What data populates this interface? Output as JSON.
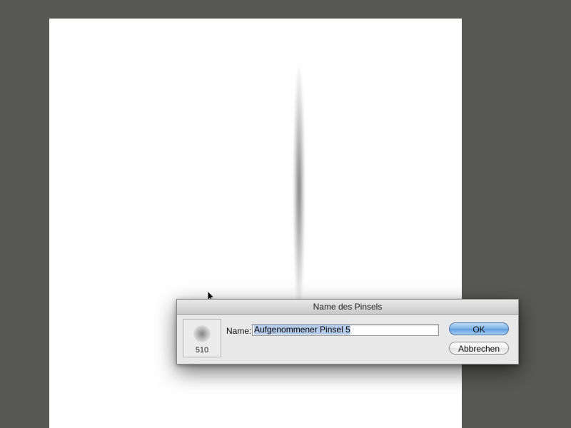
{
  "dialog": {
    "title": "Name des Pinsels",
    "brush_size": "510",
    "name_label": "Name:",
    "name_value": "Aufgenommener Pinsel 5",
    "ok_label": "OK",
    "cancel_label": "Abbrechen"
  },
  "colors": {
    "workspace_bg": "#585955",
    "canvas_bg": "#ffffff",
    "ok_accent": "#7fb2e8",
    "selection": "#b4cbea"
  },
  "icons": {
    "cursor": "arrow-cursor-icon"
  }
}
